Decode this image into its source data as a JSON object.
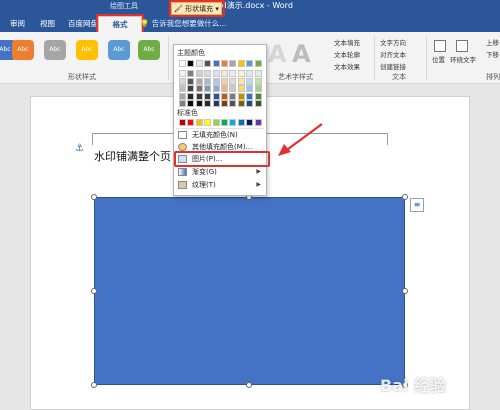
{
  "window": {
    "title": "word演示.docx - Word",
    "context_tab_group": "绘图工具"
  },
  "tabs": [
    "审阅",
    "视图",
    "百度网盘",
    "格式"
  ],
  "tell_me": "告诉我您想要做什么...",
  "ribbon": {
    "style_swatches": [
      {
        "label": "Abc",
        "color": "#4472c4"
      },
      {
        "label": "Abc",
        "color": "#ed7d31"
      },
      {
        "label": "Abc",
        "color": "#a5a5a5"
      },
      {
        "label": "Abc",
        "color": "#ffc000"
      },
      {
        "label": "Abc",
        "color": "#5b9bd5"
      },
      {
        "label": "Abc",
        "color": "#70ad47"
      }
    ],
    "shape_styles_label": "形状样式",
    "shape_fill_button": "形状填充",
    "art_styles_label": "艺术字样式",
    "text_label": "文本",
    "text_options": [
      "文字方向",
      "对齐文本",
      "创建链接"
    ],
    "art_options": [
      "文本填充",
      "文本轮廓",
      "文本效果"
    ],
    "position_label": "位置",
    "wrap_label": "环绕文字",
    "arrange_label": "排列",
    "arrange_options": [
      "上移",
      "下移"
    ]
  },
  "dropdown": {
    "theme_colors_label": "主题颜色",
    "standard_colors_label": "标准色",
    "items": [
      {
        "label": "无填充颜色(N)",
        "submenu": false
      },
      {
        "label": "其他填充颜色(M)...",
        "submenu": false
      },
      {
        "label": "图片(P)...",
        "submenu": false
      },
      {
        "label": "渐变(G)",
        "submenu": true
      },
      {
        "label": "纹理(T)",
        "submenu": true
      }
    ],
    "theme_colors": [
      [
        "#ffffff",
        "#000000",
        "#e7e6e6",
        "#44546a",
        "#4472c4",
        "#ed7d31",
        "#a5a5a5",
        "#ffc000",
        "#5b9bd5",
        "#70ad47"
      ],
      [
        "#f2f2f2",
        "#7f7f7f",
        "#d0cece",
        "#d6dce4",
        "#d9e2f3",
        "#fbe5d5",
        "#ededed",
        "#fff2cc",
        "#deebf6",
        "#e2efd9"
      ],
      [
        "#d8d8d8",
        "#595959",
        "#aeabab",
        "#adb9ca",
        "#b4c6e7",
        "#f7cbac",
        "#dbdbdb",
        "#fee599",
        "#bdd7ee",
        "#c5e0b3"
      ],
      [
        "#bfbfbf",
        "#3f3f3f",
        "#757070",
        "#8496b0",
        "#8eaadb",
        "#f4b183",
        "#c9c9c9",
        "#ffd965",
        "#9cc3e5",
        "#a8d08d"
      ],
      [
        "#a5a5a5",
        "#262626",
        "#3a3838",
        "#323f4f",
        "#2f5496",
        "#c55a11",
        "#7b7b7b",
        "#bf9000",
        "#2e75b5",
        "#538135"
      ],
      [
        "#7f7f7f",
        "#0c0c0c",
        "#171616",
        "#222a35",
        "#1f3864",
        "#833c0b",
        "#525252",
        "#7f6000",
        "#1e4e79",
        "#375623"
      ]
    ],
    "standard_colors": [
      "#c00000",
      "#ff0000",
      "#ffc000",
      "#ffff00",
      "#92d050",
      "#00b050",
      "#00b0f0",
      "#0070c0",
      "#002060",
      "#7030a0"
    ]
  },
  "document": {
    "line_text": "水印铺满整个页"
  },
  "watermark": "Bai 经验"
}
